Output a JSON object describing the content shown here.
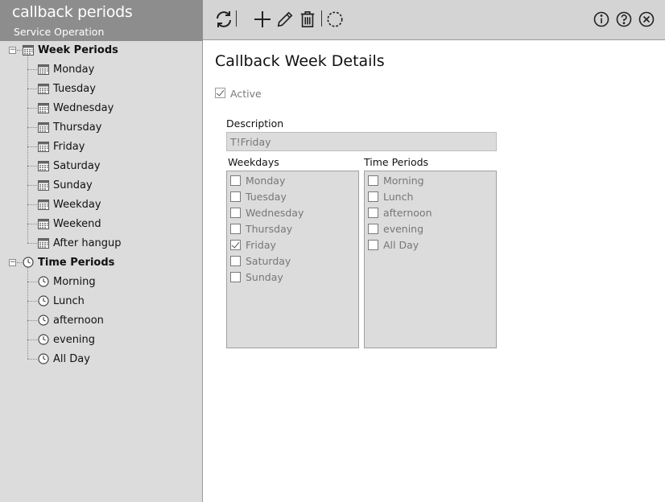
{
  "app": {
    "title": "callback periods",
    "subtitle": "Service Operation"
  },
  "tree": {
    "week_group": "Week Periods",
    "week_items": [
      "Monday",
      "Tuesday",
      "Wednesday",
      "Thursday",
      "Friday",
      "Saturday",
      "Sunday",
      "Weekday",
      "Weekend",
      "After hangup"
    ],
    "time_group": "Time Periods",
    "time_items": [
      "Morning",
      "Lunch",
      "afternoon",
      "evening",
      "All Day"
    ]
  },
  "toolbar": {
    "left_icons": [
      "refresh-icon",
      "add-icon",
      "edit-icon",
      "delete-icon",
      "spinner-icon"
    ],
    "right_icons": [
      "info-icon",
      "help-icon",
      "close-icon"
    ]
  },
  "details": {
    "title": "Callback Week Details",
    "active_label": "Active",
    "active_checked": true,
    "description_label": "Description",
    "description_value": "T!Friday",
    "weekdays_label": "Weekdays",
    "weekdays": [
      {
        "label": "Monday",
        "checked": false
      },
      {
        "label": "Tuesday",
        "checked": false
      },
      {
        "label": "Wednesday",
        "checked": false
      },
      {
        "label": "Thursday",
        "checked": false
      },
      {
        "label": "Friday",
        "checked": true
      },
      {
        "label": "Saturday",
        "checked": false
      },
      {
        "label": "Sunday",
        "checked": false
      }
    ],
    "time_periods_label": "Time Periods",
    "time_periods": [
      {
        "label": "Morning",
        "checked": false
      },
      {
        "label": "Lunch",
        "checked": false
      },
      {
        "label": "afternoon",
        "checked": false
      },
      {
        "label": "evening",
        "checked": false
      },
      {
        "label": "All Day",
        "checked": false
      }
    ]
  }
}
